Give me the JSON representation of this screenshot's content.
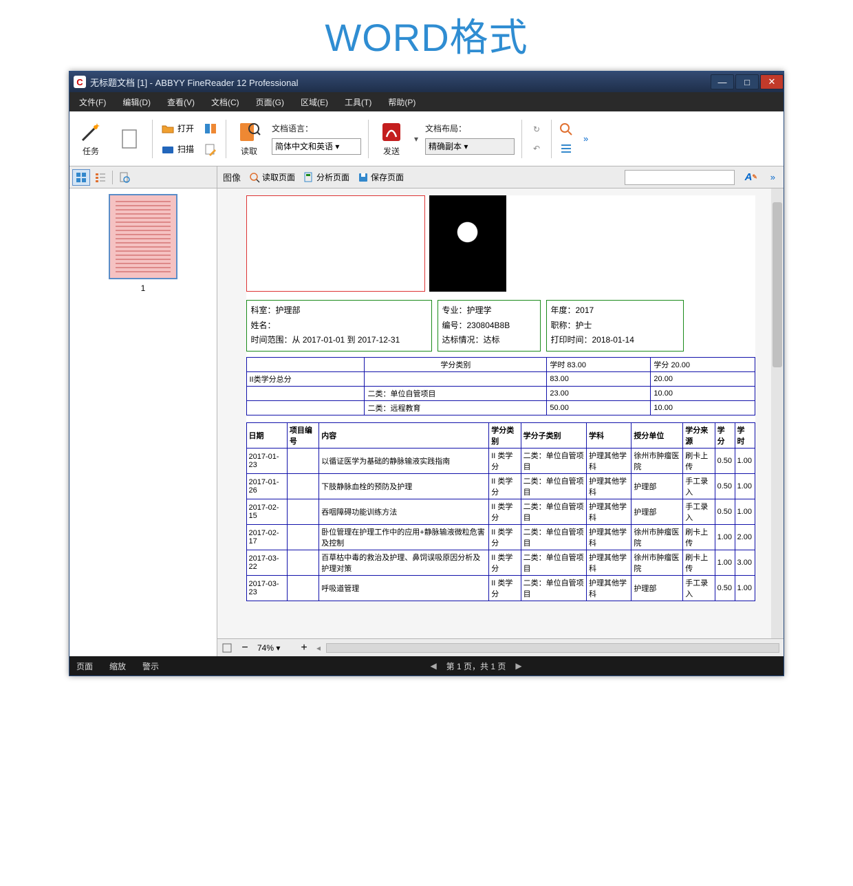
{
  "banner": "WORD格式",
  "titlebar": {
    "icon": "C",
    "title": "无标题文档 [1] - ABBYY FineReader 12 Professional"
  },
  "menu": [
    "文件(F)",
    "编辑(D)",
    "查看(V)",
    "文档(C)",
    "页面(G)",
    "区域(E)",
    "工具(T)",
    "帮助(P)"
  ],
  "ribbon": {
    "task": "任务",
    "open": "打开",
    "scan": "扫描",
    "read": "读取",
    "lang_label": "文档语言：",
    "lang_value": "简体中文和英语",
    "send": "发送",
    "layout_label": "文档布局：",
    "layout_value": "精确副本"
  },
  "toolbar2": {
    "label": "图像",
    "read_page": "读取页面",
    "analyze_page": "分析页面",
    "save_page": "保存页面",
    "style": "A"
  },
  "thumb_num": "1",
  "doc": {
    "info": {
      "box1": [
        "科室：护理部",
        "姓名：",
        "时间范围：从 2017-01-01 到 2017-12-31"
      ],
      "box2": [
        "专业：护理学",
        "编号：230804B8B",
        "达标情况：达标"
      ],
      "box3": [
        "年度：2017",
        "职称：护士",
        "打印时间：2018-01-14"
      ]
    },
    "summary": {
      "header": [
        "",
        "学分类别",
        "学时 83.00",
        "学分 20.00"
      ],
      "rows": [
        [
          "II类学分总分",
          "",
          "83.00",
          "20.00"
        ],
        [
          "",
          "二类：单位自管项目",
          "23.00",
          "10.00"
        ],
        [
          "",
          "二类：远程教育",
          "50.00",
          "10.00"
        ]
      ]
    },
    "table": {
      "headers": [
        "日期",
        "项目编号",
        "内容",
        "学分类别",
        "学分子类别",
        "学科",
        "授分单位",
        "学分来源",
        "学分",
        "学时"
      ],
      "rows": [
        [
          "2017-01-23",
          "",
          "以循证医学为基础的静脉输液实践指南",
          "II 类学分",
          "二类：单位自管项目",
          "护理其他学科",
          "徐州市肿瘤医院",
          "刷卡上传",
          "0.50",
          "1.00"
        ],
        [
          "2017-01-26",
          "",
          "下肢静脉血栓的预防及护理",
          "II 类学分",
          "二类：单位自管项目",
          "护理其他学科",
          "护理部",
          "手工录入",
          "0.50",
          "1.00"
        ],
        [
          "2017-02-15",
          "",
          "吞咽障碍功能训练方法",
          "II 类学分",
          "二类：单位自管项目",
          "护理其他学科",
          "护理部",
          "手工录入",
          "0.50",
          "1.00"
        ],
        [
          "2017-02-17",
          "",
          "卧位管理在护理工作中的应用+静脉输液微粒危害及控制",
          "II 类学分",
          "二类：单位自管项目",
          "护理其他学科",
          "徐州市肿瘤医院",
          "刷卡上传",
          "1.00",
          "2.00"
        ],
        [
          "2017-03-22",
          "",
          "百草枯中毒的救治及护理、鼻饲误吸原因分析及护理对策",
          "II 类学分",
          "二类：单位自管项目",
          "护理其他学科",
          "徐州市肿瘤医院",
          "刷卡上传",
          "1.00",
          "3.00"
        ],
        [
          "2017-03-23",
          "",
          "呼吸道管理",
          "II 类学分",
          "二类：单位自管项目",
          "护理其他学科",
          "护理部",
          "手工录入",
          "0.50",
          "1.00"
        ]
      ]
    }
  },
  "zoom": "74%",
  "status": {
    "page": "页面",
    "zoom": "缩放",
    "warn": "警示",
    "nav": "第 1 页，共 1 页"
  }
}
